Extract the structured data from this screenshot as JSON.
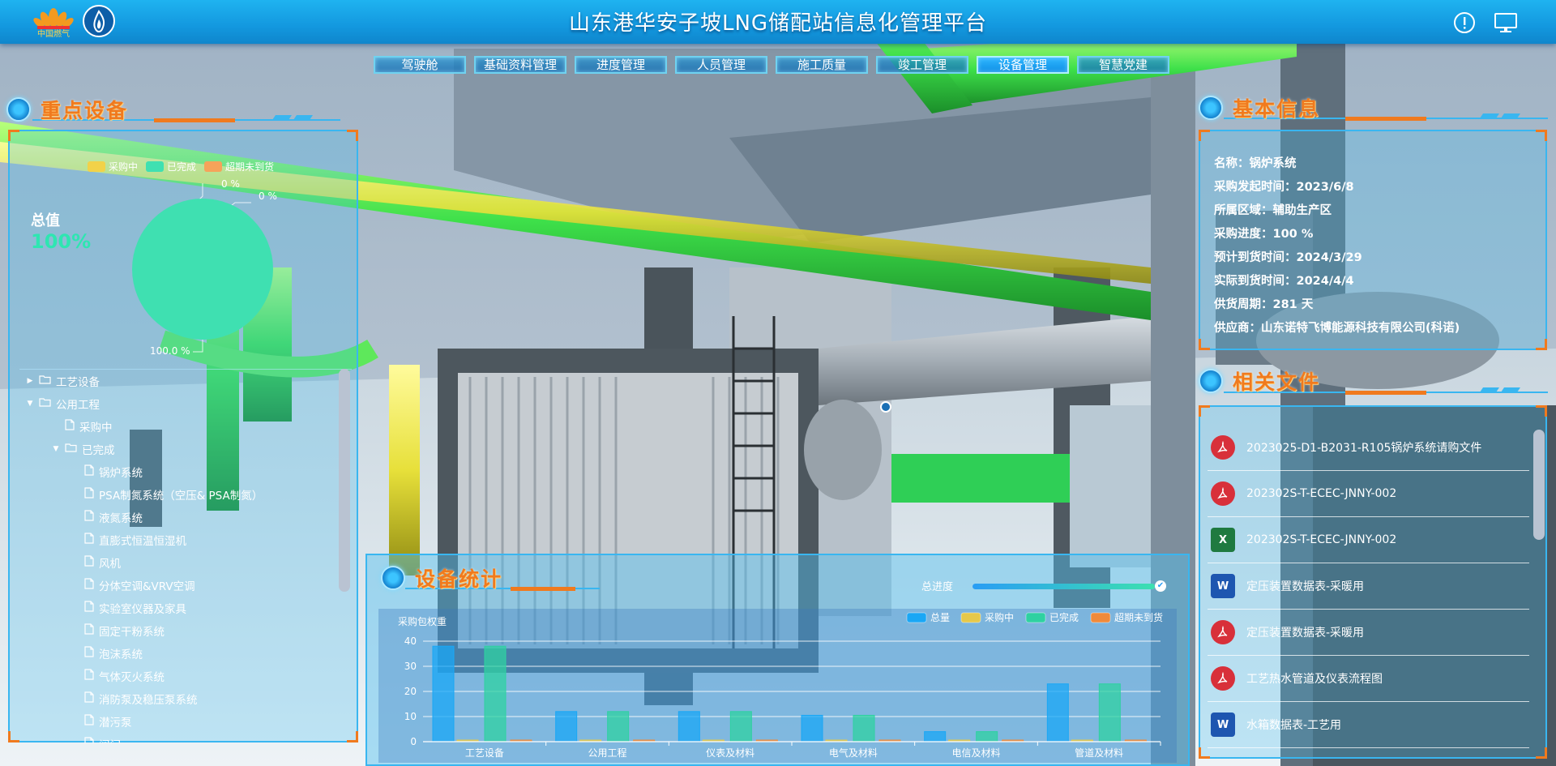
{
  "header": {
    "title": "山东港华安子坡LNG储配站信息化管理平台",
    "logo_text": "中国燃气"
  },
  "nav": [
    {
      "label": "驾驶舱",
      "active": false
    },
    {
      "label": "基础资料管理",
      "active": false
    },
    {
      "label": "进度管理",
      "active": false
    },
    {
      "label": "人员管理",
      "active": false
    },
    {
      "label": "施工质量",
      "active": false
    },
    {
      "label": "竣工管理",
      "active": false
    },
    {
      "label": "设备管理",
      "active": true
    },
    {
      "label": "智慧党建",
      "active": false
    }
  ],
  "key_equipment": {
    "title": "重点设备",
    "legend": [
      {
        "label": "采购中",
        "color": "#f2d249"
      },
      {
        "label": "已完成",
        "color": "#3fe0b1"
      },
      {
        "label": "超期未到货",
        "color": "#f5a35a"
      }
    ],
    "total_label": "总值",
    "total_value": "100%",
    "pie_labels": [
      "0 %",
      "0 %",
      "100.0 %"
    ],
    "tree": [
      {
        "label": "工艺设备",
        "level": 0,
        "type": "folder",
        "arrow": "right"
      },
      {
        "label": "公用工程",
        "level": 0,
        "type": "folder-open",
        "arrow": "down"
      },
      {
        "label": "采购中",
        "level": 1,
        "type": "file",
        "arrow": ""
      },
      {
        "label": "已完成",
        "level": 1,
        "type": "folder-open",
        "arrow": "down"
      },
      {
        "label": "锅炉系统",
        "level": 2,
        "type": "file",
        "arrow": ""
      },
      {
        "label": "PSA制氮系统（空压& PSA制氮）",
        "level": 2,
        "type": "file",
        "arrow": ""
      },
      {
        "label": "液氮系统",
        "level": 2,
        "type": "file",
        "arrow": ""
      },
      {
        "label": "直膨式恒温恒湿机",
        "level": 2,
        "type": "file",
        "arrow": ""
      },
      {
        "label": "风机",
        "level": 2,
        "type": "file",
        "arrow": ""
      },
      {
        "label": "分体空调&VRV空调",
        "level": 2,
        "type": "file",
        "arrow": ""
      },
      {
        "label": "实验室仪器及家具",
        "level": 2,
        "type": "file",
        "arrow": ""
      },
      {
        "label": "固定干粉系统",
        "level": 2,
        "type": "file",
        "arrow": ""
      },
      {
        "label": "泡沫系统",
        "level": 2,
        "type": "file",
        "arrow": ""
      },
      {
        "label": "气体灭火系统",
        "level": 2,
        "type": "file",
        "arrow": ""
      },
      {
        "label": "消防泵及稳压泵系统",
        "level": 2,
        "type": "file",
        "arrow": ""
      },
      {
        "label": "潜污泵",
        "level": 2,
        "type": "file",
        "arrow": ""
      },
      {
        "label": "阀门",
        "level": 2,
        "type": "file",
        "arrow": ""
      }
    ]
  },
  "basic_info": {
    "title": "基本信息",
    "lines": [
      "名称：锅炉系统",
      "采购发起时间：2023/6/8",
      "所属区域：辅助生产区",
      "采购进度：100 %",
      "预计到货时间：2024/3/29",
      "实际到货时间：2024/4/4",
      "供货周期：281 天",
      "供应商：山东诺特飞博能源科技有限公司(科诺)"
    ]
  },
  "related_files": {
    "title": "相关文件",
    "files": [
      {
        "name": "2023025-D1-B2031-R105锅炉系统请购文件",
        "type": "pdf"
      },
      {
        "name": "202302S-T-ECEC-JNNY-002",
        "type": "pdf"
      },
      {
        "name": "202302S-T-ECEC-JNNY-002",
        "type": "xls"
      },
      {
        "name": "定压装置数据表-采暖用",
        "type": "doc"
      },
      {
        "name": "定压装置数据表-采暖用",
        "type": "pdf"
      },
      {
        "name": "工艺热水管道及仪表流程图",
        "type": "pdf"
      },
      {
        "name": "水箱数据表-工艺用",
        "type": "doc"
      }
    ]
  },
  "equipment_stats": {
    "title": "设备统计",
    "progress_label": "总进度",
    "progress_value": 1.0
  },
  "chart_data": {
    "type": "bar",
    "ylabel": "采购包权重",
    "ylim": [
      0,
      40
    ],
    "yticks": [
      0,
      10,
      20,
      30,
      40
    ],
    "categories": [
      "工艺设备",
      "公用工程",
      "仪表及材料",
      "电气及材料",
      "电信及材料",
      "管道及材料"
    ],
    "series": [
      {
        "name": "总量",
        "color": "#1aa7f5",
        "values": [
          38,
          12,
          12,
          10.5,
          4,
          23
        ]
      },
      {
        "name": "采购中",
        "color": "#e6c84a",
        "values": [
          0,
          0,
          0,
          0,
          0,
          0
        ]
      },
      {
        "name": "已完成",
        "color": "#2fd1a1",
        "values": [
          38,
          12,
          12,
          10.5,
          4,
          23
        ]
      },
      {
        "name": "超期未到货",
        "color": "#f08a3a",
        "values": [
          0,
          0,
          0,
          0,
          0,
          0
        ]
      }
    ],
    "grid": true,
    "legend": "top-right"
  }
}
